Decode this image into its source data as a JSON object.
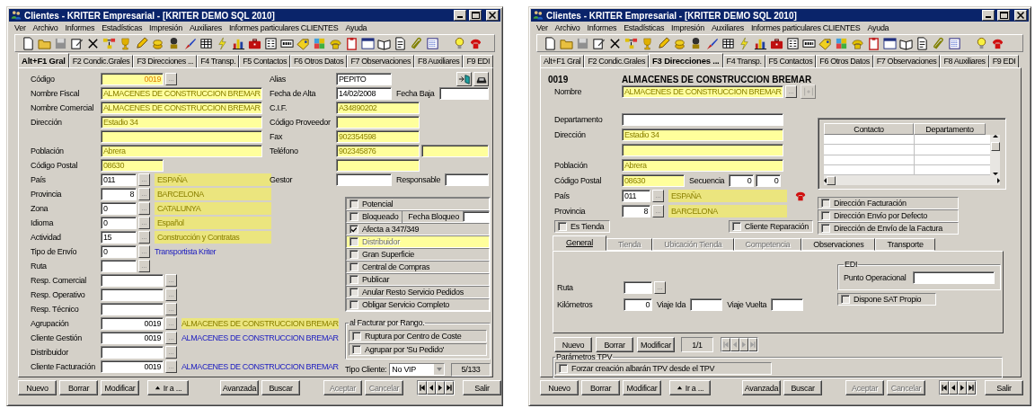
{
  "windows": [
    {
      "title": "Clientes - KRITER Empresarial - [KRITER DEMO SQL 2010]",
      "menu": [
        "Ver",
        "Archivo",
        "Informes",
        "Estadísticas",
        "Impresión",
        "Auxiliares",
        "Informes particulares CLIENTES",
        "Ayuda"
      ],
      "tabs": [
        {
          "label": "Alt+F1 Gral",
          "selected": true
        },
        {
          "label": "F2 Condic.Grales",
          "selected": false
        },
        {
          "label": "F3 Direcciones ...",
          "selected": false
        },
        {
          "label": "F4 Transp.",
          "selected": false
        },
        {
          "label": "F5 Contactos",
          "selected": false
        },
        {
          "label": "F6 Otros Datos",
          "selected": false
        },
        {
          "label": "F7 Observaciones",
          "selected": false
        },
        {
          "label": "F8 Auxiliares",
          "selected": false
        },
        {
          "label": "F9 EDI",
          "selected": false
        }
      ],
      "form": {
        "kind": "general",
        "upper_left": [
          {
            "label": "Código",
            "cells": [
              {
                "kind": "midfield",
                "value": "0019",
                "highlighted": true,
                "numeric": true
              },
              {
                "kind": "ellipsis",
                "label": "..."
              }
            ]
          },
          {
            "label": "Nombre Fiscal",
            "cells": [
              {
                "kind": "longfield",
                "value": "ALMACENES DE CONSTRUCCION BREMAR",
                "highlighted": true
              }
            ]
          },
          {
            "label": "Nombre Comercial",
            "cells": [
              {
                "kind": "longfield",
                "value": "ALMACENES DE CONSTRUCCION BREMAR",
                "highlighted": true
              }
            ]
          },
          {
            "label": "Dirección",
            "cells": [
              {
                "kind": "longfield",
                "value": "Estadio 34",
                "highlighted": true
              }
            ]
          },
          {
            "cells": [
              {
                "kind": "longfield",
                "highlighted": true
              }
            ]
          },
          {
            "label": "Población",
            "cells": [
              {
                "kind": "longfield",
                "value": "Abrera",
                "highlighted": true
              }
            ]
          },
          {
            "label": "Código Postal",
            "cells": [
              {
                "kind": "midfield",
                "value": "08630",
                "highlighted": true
              }
            ]
          },
          {
            "label": "País",
            "cells": [
              {
                "kind": "codefield",
                "value": "011",
                "highlighted": false
              },
              {
                "kind": "ellipsis",
                "label": "..."
              },
              {
                "kind": "lookup",
                "text": "ESPAÑA"
              }
            ]
          }
        ],
        "upper_right": [
          {
            "label": "Alias",
            "cells": [
              {
                "kind": "shortfield",
                "value": "PEPITO",
                "highlighted": false
              },
              {
                "kind": "tool",
                "disabled": false
              },
              {
                "kind": "tool",
                "disabled": false
              }
            ]
          },
          {
            "label": "Fecha de Alta",
            "cells": [
              {
                "kind": "shortfield",
                "value": "14/02/2008",
                "highlighted": false
              },
              {
                "kind": "caption",
                "text": "Fecha Baja"
              },
              {
                "kind": "fillfield",
                "highlighted": false
              }
            ]
          },
          {
            "label": "C.I.F.",
            "cells": [
              {
                "kind": "halffield",
                "value": "A34890202",
                "highlighted": true
              }
            ]
          },
          {
            "label": "Código Proveedor",
            "cells": [
              {
                "kind": "halffield",
                "highlighted": true
              }
            ]
          },
          {
            "label": "Fax",
            "cells": [
              {
                "kind": "halffield",
                "value": "902354598",
                "highlighted": true
              }
            ]
          },
          {
            "label": "Teléfono",
            "cells": [
              {
                "kind": "halffield",
                "value": "902345876",
                "highlighted": true
              },
              {
                "kind": "fillfield",
                "highlighted": true
              }
            ]
          },
          {
            "cells": [
              {
                "kind": "halffield",
                "highlighted": true
              }
            ]
          },
          {
            "label": "Gestor",
            "cells": [
              {
                "kind": "shortfield",
                "highlighted": false
              },
              {
                "kind": "caption",
                "text": "Responsable"
              },
              {
                "kind": "fillfield",
                "highlighted": false
              }
            ]
          }
        ],
        "lower_left": [
          {
            "label": "Provincia",
            "cells": [
              {
                "kind": "codefield",
                "value": "8",
                "highlighted": false,
                "numeric": true
              },
              {
                "kind": "ellipsis",
                "label": "..."
              },
              {
                "kind": "lookup",
                "text": "BARCELONA"
              }
            ]
          },
          {
            "label": "Zona",
            "cells": [
              {
                "kind": "codefield",
                "value": "0",
                "highlighted": false
              },
              {
                "kind": "ellipsis",
                "label": "..."
              },
              {
                "kind": "lookup",
                "text": "CATALUNYA"
              }
            ]
          },
          {
            "label": "Idioma",
            "cells": [
              {
                "kind": "codefield",
                "value": "0",
                "highlighted": false
              },
              {
                "kind": "ellipsis",
                "label": "..."
              },
              {
                "kind": "lookup",
                "text": "Español"
              }
            ]
          },
          {
            "label": "Actividad",
            "cells": [
              {
                "kind": "codefield",
                "value": "15",
                "highlighted": false
              },
              {
                "kind": "ellipsis",
                "label": "..."
              },
              {
                "kind": "lookup",
                "text": "Construcción y Contratas"
              }
            ]
          },
          {
            "label": "Tipo de Envío",
            "cells": [
              {
                "kind": "codefield",
                "value": "0",
                "highlighted": false
              },
              {
                "kind": "ellipsis",
                "label": "..."
              },
              {
                "kind": "link",
                "text": "Transportista Kriter"
              }
            ]
          },
          {
            "label": "Ruta",
            "cells": [
              {
                "kind": "codefield",
                "highlighted": false
              },
              {
                "kind": "ellipsis",
                "label": "..."
              }
            ]
          },
          {
            "label": "Resp. Comercial",
            "cells": [
              {
                "kind": "midfield",
                "highlighted": false
              },
              {
                "kind": "ellipsis",
                "label": "..."
              }
            ]
          },
          {
            "label": "Resp. Operativo",
            "cells": [
              {
                "kind": "midfield",
                "highlighted": false
              },
              {
                "kind": "ellipsis",
                "label": "..."
              }
            ]
          },
          {
            "label": "Resp. Técnico",
            "cells": [
              {
                "kind": "midfield",
                "highlighted": false
              },
              {
                "kind": "ellipsis",
                "label": "..."
              }
            ]
          },
          {
            "label": "Agrupación",
            "cells": [
              {
                "kind": "midfield",
                "value": "0019",
                "highlighted": false,
                "numeric": true
              },
              {
                "kind": "ellipsis",
                "label": "..."
              },
              {
                "kind": "highlight",
                "text": "ALMACENES DE CONSTRUCCION BREMAR"
              }
            ]
          },
          {
            "label": "Cliente Gestión",
            "cells": [
              {
                "kind": "midfield",
                "value": "0019",
                "highlighted": false,
                "numeric": true
              },
              {
                "kind": "ellipsis",
                "label": "..."
              },
              {
                "kind": "link",
                "text": "ALMACENES DE CONSTRUCCION BREMAR"
              }
            ]
          },
          {
            "label": "Distribuidor",
            "cells": [
              {
                "kind": "midfield",
                "highlighted": false
              },
              {
                "kind": "ellipsis",
                "label": "..."
              }
            ]
          },
          {
            "label": "Cliente Facturación",
            "cells": [
              {
                "kind": "midfield",
                "value": "0019",
                "highlighted": false,
                "numeric": true
              },
              {
                "kind": "ellipsis",
                "label": "..."
              },
              {
                "kind": "link",
                "text": "ALMACENES DE CONSTRUCCION BREMAR"
              }
            ]
          }
        ],
        "options": [
          {
            "label": "Potencial",
            "checked": false,
            "disabled": false,
            "highlighted": false
          },
          {
            "label": "Bloqueado",
            "checked": false,
            "disabled": false,
            "highlighted": false,
            "date": {
              "label": "Fecha Bloqueo"
            }
          },
          {
            "label": "Afecta a 347/349",
            "checked": true,
            "disabled": false,
            "highlighted": false
          },
          {
            "label": "Distribuidor",
            "checked": false,
            "disabled": true,
            "highlighted": true
          },
          {
            "label": "Gran Superficie",
            "checked": false,
            "disabled": false,
            "highlighted": false
          },
          {
            "label": "Central de Compras",
            "checked": false,
            "disabled": false,
            "highlighted": false
          },
          {
            "label": "Publicar",
            "checked": false,
            "disabled": false,
            "highlighted": false
          },
          {
            "label": "Anular Resto Servicio Pedidos",
            "checked": false,
            "disabled": false,
            "highlighted": false
          },
          {
            "label": "Obligar Servicio Completo",
            "checked": false,
            "disabled": false,
            "highlighted": false
          }
        ],
        "group": {
          "title": "al Facturar por Rango.",
          "options": [
            {
              "label": "Ruptura por Centro de Coste",
              "checked": false,
              "disabled": false,
              "highlighted": false
            },
            {
              "label": "Agrupar por 'Su Pedido'",
              "checked": false,
              "disabled": false,
              "highlighted": false
            }
          ]
        },
        "client_type": {
          "label": "Tipo Cliente:",
          "value": "No VIP"
        },
        "counter": "5/133"
      },
      "buttons": [
        [
          {
            "label": "Nuevo",
            "kind": "text",
            "disabled": false
          },
          {
            "label": "Borrar",
            "kind": "text",
            "disabled": false
          },
          {
            "label": "Modificar",
            "kind": "text",
            "disabled": false
          }
        ],
        [
          {
            "label": "Ir a ...",
            "kind": "goto",
            "disabled": false
          }
        ],
        [
          {
            "label": "Avanzada",
            "kind": "text",
            "disabled": false
          },
          {
            "label": "Buscar",
            "kind": "text",
            "disabled": false
          }
        ],
        [
          {
            "label": "Aceptar",
            "kind": "text",
            "disabled": true
          },
          {
            "label": "Cancelar",
            "kind": "text",
            "disabled": true
          }
        ],
        [
          {
            "kind": "nav",
            "disabled": false
          }
        ],
        [
          {
            "label": "Salir",
            "kind": "text",
            "disabled": false
          }
        ]
      ]
    },
    {
      "title": "Clientes - KRITER Empresarial - [KRITER DEMO SQL 2010]",
      "menu": [
        "Ver",
        "Archivo",
        "Informes",
        "Estadísticas",
        "Impresión",
        "Auxiliares",
        "Informes particulares CLIENTES",
        "Ayuda"
      ],
      "tabs": [
        {
          "label": "Alt+F1 Gral",
          "selected": false
        },
        {
          "label": "F2 Condic.Grales",
          "selected": false
        },
        {
          "label": "F3 Direcciones ...",
          "selected": true
        },
        {
          "label": "F4 Transp.",
          "selected": false
        },
        {
          "label": "F5 Contactos",
          "selected": false
        },
        {
          "label": "F6 Otros Datos",
          "selected": false
        },
        {
          "label": "F7 Observaciones",
          "selected": false
        },
        {
          "label": "F8 Auxiliares",
          "selected": false
        },
        {
          "label": "F9 EDI",
          "selected": false
        }
      ],
      "form": {
        "kind": "addresses",
        "code": "0019",
        "name": "ALMACENES DE CONSTRUCCION BREMAR",
        "name_row": {
          "label": "Nombre",
          "cells": [
            {
              "kind": "longfield",
              "value": "ALMACENES DE CONSTRUCCION BREMAR",
              "highlighted": true
            },
            {
              "kind": "ellipsis",
              "label": "..."
            },
            {
              "kind": "tool",
              "disabled": true
            }
          ]
        },
        "rows": [
          {
            "label": "Departamento",
            "cells": [
              {
                "kind": "longfield",
                "highlighted": false
              }
            ]
          },
          {
            "label": "Dirección",
            "cells": [
              {
                "kind": "longfield",
                "value": "Estadio 34",
                "highlighted": true
              }
            ]
          },
          {
            "cells": [
              {
                "kind": "longfield",
                "highlighted": true
              }
            ]
          },
          {
            "label": "Población",
            "cells": [
              {
                "kind": "longfield",
                "value": "Abrera",
                "highlighted": true
              }
            ]
          },
          {
            "label": "Código Postal",
            "cells": [
              {
                "kind": "midfield",
                "value": "08630",
                "highlighted": true
              },
              {
                "kind": "caption",
                "text": "Secuencia"
              },
              {
                "kind": "seqfield",
                "value": "0",
                "highlighted": false,
                "numeric": true
              },
              {
                "kind": "seqfield",
                "value": "0",
                "highlighted": false,
                "numeric": true
              }
            ]
          },
          {
            "label": "País",
            "cells": [
              {
                "kind": "tinyfield",
                "value": "011",
                "highlighted": false
              },
              {
                "kind": "ellipsis",
                "label": "..."
              },
              {
                "kind": "lookup",
                "text": "ESPAÑA"
              },
              {
                "kind": "marker"
              }
            ]
          },
          {
            "label": "Provincia",
            "cells": [
              {
                "kind": "tinyfield",
                "value": "8",
                "highlighted": false,
                "numeric": true
              },
              {
                "kind": "ellipsis",
                "label": "..."
              },
              {
                "kind": "lookup",
                "text": "BARCELONA"
              }
            ]
          }
        ],
        "flags": [
          {
            "label": "Es Tienda",
            "checked": false,
            "disabled": false,
            "highlighted": false
          },
          {
            "label": "Cliente Reparación",
            "checked": false,
            "disabled": false,
            "highlighted": false
          }
        ],
        "contacts": {
          "columns": [
            "Contacto",
            "Departamento"
          ]
        },
        "address_options": [
          {
            "label": "Dirección Facturación",
            "checked": false,
            "disabled": false,
            "highlighted": false
          },
          {
            "label": "Dirección Envío por Defecto",
            "checked": false,
            "disabled": false,
            "highlighted": false
          },
          {
            "label": "Dirección de Envío de la Factura",
            "checked": false,
            "disabled": false,
            "highlighted": false
          }
        ],
        "subtabs": [
          {
            "label": "General",
            "selected": true,
            "disabled": false
          },
          {
            "label": "Tienda",
            "selected": false,
            "disabled": true
          },
          {
            "label": "Ubicación Tienda",
            "selected": false,
            "disabled": true
          },
          {
            "label": "Competencia",
            "selected": false,
            "disabled": true
          },
          {
            "label": "Observaciones",
            "selected": false,
            "disabled": false
          },
          {
            "label": "Transporte",
            "selected": false,
            "disabled": false
          }
        ],
        "general": {
          "rows": [
            {
              "label": "Ruta",
              "cells": [
                {
                  "kind": "tinyfield",
                  "highlighted": false
                },
                {
                  "kind": "ellipsis",
                  "label": "..."
                }
              ]
            },
            {
              "label": "Kilómetros",
              "cells": [
                {
                  "kind": "tinyfield",
                  "value": "0",
                  "highlighted": false,
                  "numeric": true
                },
                {
                  "kind": "caption",
                  "text": "Viaje Ida"
                },
                {
                  "kind": "tripfield",
                  "highlighted": false
                },
                {
                  "kind": "caption",
                  "text": "Viaje Vuelta"
                },
                {
                  "kind": "tripfield",
                  "highlighted": false
                }
              ]
            }
          ],
          "edi": {
            "title": "EDI",
            "label": "Punto Operacional"
          },
          "options": [
            {
              "label": "Dispone SAT Propio",
              "checked": false,
              "disabled": false,
              "highlighted": false
            }
          ]
        },
        "record_buttons": [
          {
            "label": "Nuevo",
            "kind": "text",
            "disabled": false
          },
          {
            "label": "Borrar",
            "kind": "text",
            "disabled": false
          },
          {
            "label": "Modificar",
            "kind": "text",
            "disabled": false
          },
          {
            "label": "1/1",
            "kind": "counter"
          },
          {
            "kind": "nav",
            "disabled": true
          }
        ],
        "tpv": {
          "title": "Parámetros TPV",
          "options": [
            {
              "label": "Forzar creación albarán TPV desde el TPV",
              "checked": false,
              "disabled": false,
              "highlighted": false
            }
          ]
        }
      },
      "buttons": [
        [
          {
            "label": "Nuevo",
            "kind": "text",
            "disabled": false
          },
          {
            "label": "Borrar",
            "kind": "text",
            "disabled": false
          },
          {
            "label": "Modificar",
            "kind": "text",
            "disabled": false
          }
        ],
        [
          {
            "label": "Ir a ...",
            "kind": "goto",
            "disabled": false
          }
        ],
        [
          {
            "label": "Avanzada",
            "kind": "text",
            "disabled": false
          },
          {
            "label": "Buscar",
            "kind": "text",
            "disabled": false
          }
        ],
        [
          {
            "label": "Aceptar",
            "kind": "text",
            "disabled": true
          },
          {
            "label": "Cancelar",
            "kind": "text",
            "disabled": true
          }
        ],
        [
          {
            "kind": "nav",
            "disabled": false
          }
        ],
        [
          {
            "label": "Salir",
            "kind": "text",
            "disabled": false
          }
        ]
      ]
    }
  ]
}
